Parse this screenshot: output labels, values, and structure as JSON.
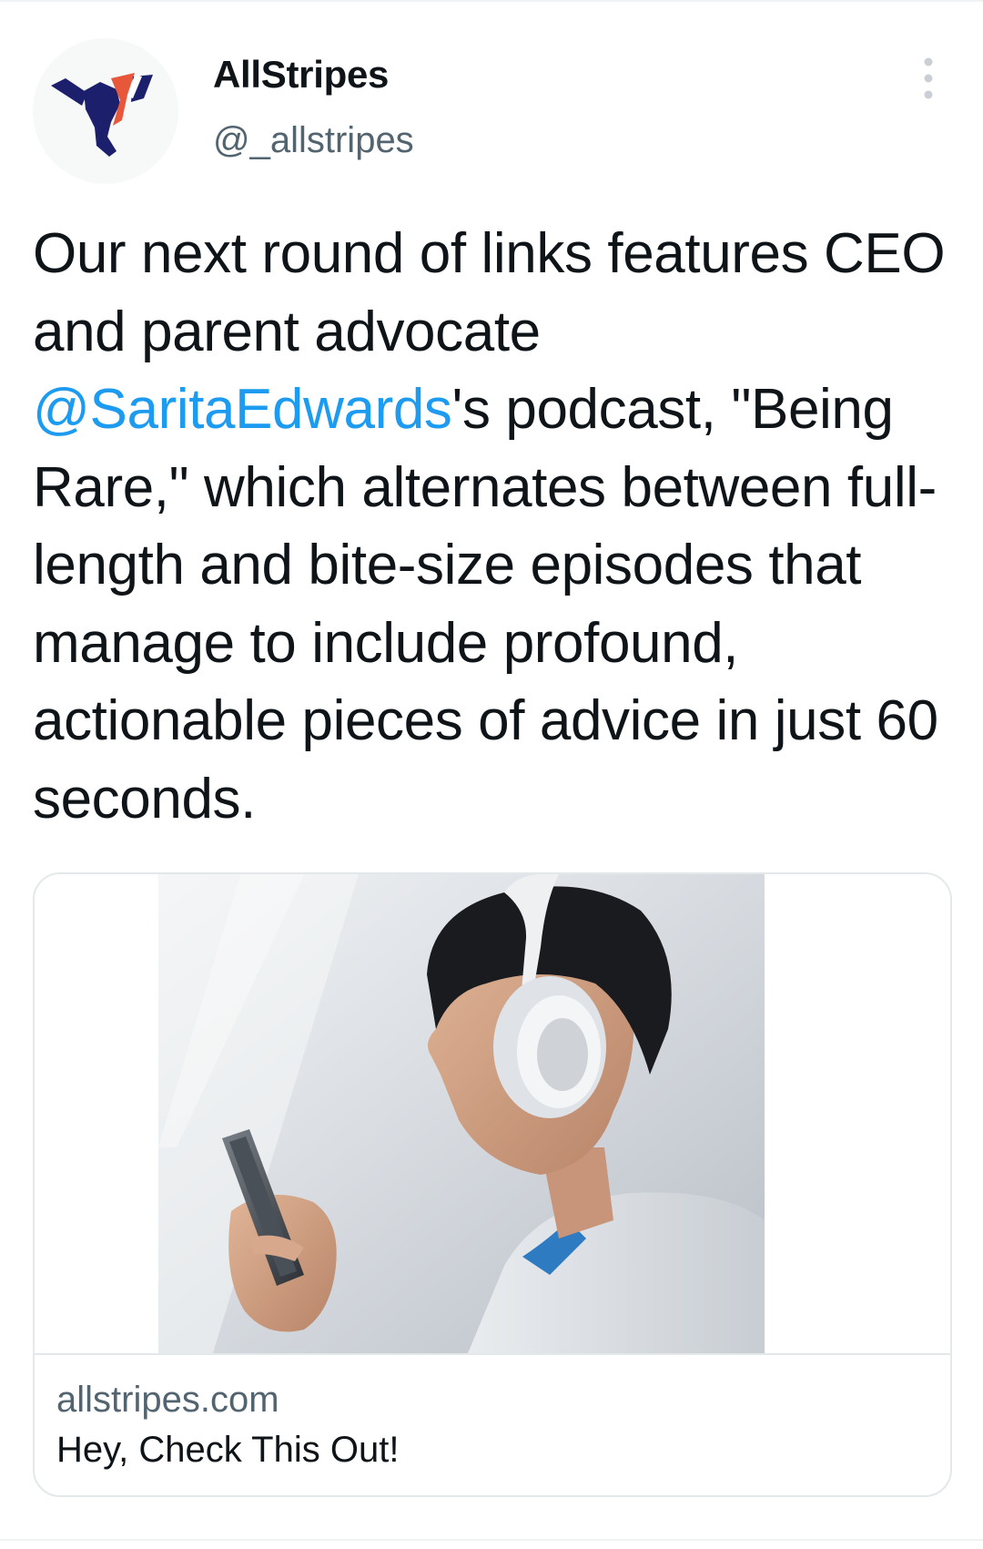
{
  "author": {
    "display_name": "AllStripes",
    "handle": "@_allstripes",
    "avatar_icon": "allstripes-logo-icon"
  },
  "menu": {
    "icon": "more-vertical-icon"
  },
  "tweet": {
    "text_before_mention": "Our next round of links features CEO and parent advocate ",
    "mention": "@SaritaEdwards",
    "text_after_mention": "'s podcast, \"Being Rare,\" which alternates between full-length and bite-size episodes that manage to include profound, actionable pieces of advice in just 60 seconds."
  },
  "link_card": {
    "image": "man-with-headphones-looking-at-phone",
    "domain": "allstripes.com",
    "title": "Hey, Check This Out!"
  },
  "colors": {
    "link": "#1d9bf0",
    "text": "#0f1419",
    "secondary_text": "#536471",
    "border": "#e3e8eb",
    "logo_navy": "#1c1f6b",
    "logo_orange": "#e8573a"
  }
}
